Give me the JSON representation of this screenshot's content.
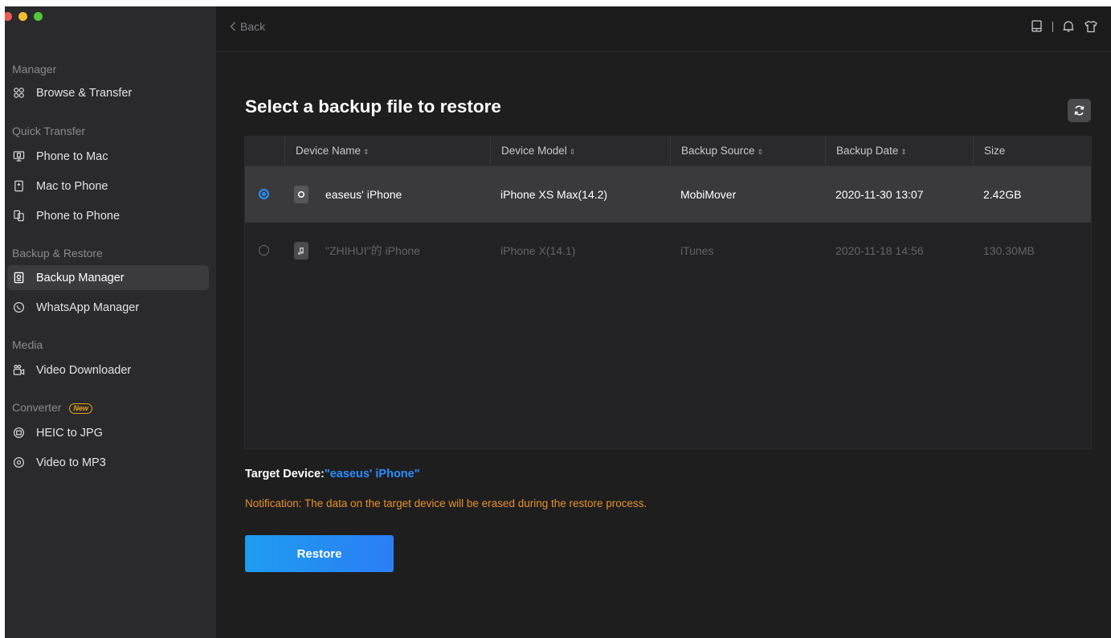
{
  "sidebar": {
    "sections": {
      "manager": "Manager",
      "quick_transfer": "Quick Transfer",
      "backup_restore": "Backup & Restore",
      "media": "Media",
      "converter": "Converter",
      "converter_badge": "New"
    },
    "items": {
      "browse_transfer": "Browse & Transfer",
      "phone_to_mac": "Phone to Mac",
      "mac_to_phone": "Mac to Phone",
      "phone_to_phone": "Phone to Phone",
      "backup_manager": "Backup Manager",
      "whatsapp_manager": "WhatsApp Manager",
      "video_downloader": "Video Downloader",
      "heic_to_jpg": "HEIC to JPG",
      "video_to_mp3": "Video to MP3"
    },
    "active_item": "Backup Manager"
  },
  "topbar": {
    "back_label": "Back"
  },
  "main": {
    "title": "Select a backup file to restore",
    "columns": [
      "Device Name",
      "Device Model",
      "Backup Source",
      "Backup Date",
      "Size"
    ],
    "sort_glyph": "⇕",
    "rows": [
      {
        "device_name": "easeus' iPhone",
        "device_model": "iPhone XS Max(14.2)",
        "backup_source": "MobiMover",
        "backup_date": "2020-11-30 13:07",
        "size": "2.42GB",
        "selected": true
      },
      {
        "device_name": "\"ZHIHUI\"的 iPhone",
        "device_model": "iPhone X(14.1)",
        "backup_source": "iTunes",
        "backup_date": "2020-11-18 14:56",
        "size": "130.30MB",
        "selected": false
      }
    ],
    "target_label": "Target Device:",
    "target_device": "\"easeus' iPhone\"",
    "notification": "Notification: The data on the target device will be erased during the restore process.",
    "restore_label": "Restore"
  },
  "colors": {
    "accent": "#2b8dff",
    "warning": "#e7912a",
    "sidebar_bg": "#2a2a2c",
    "main_bg": "#1e1e1f"
  }
}
